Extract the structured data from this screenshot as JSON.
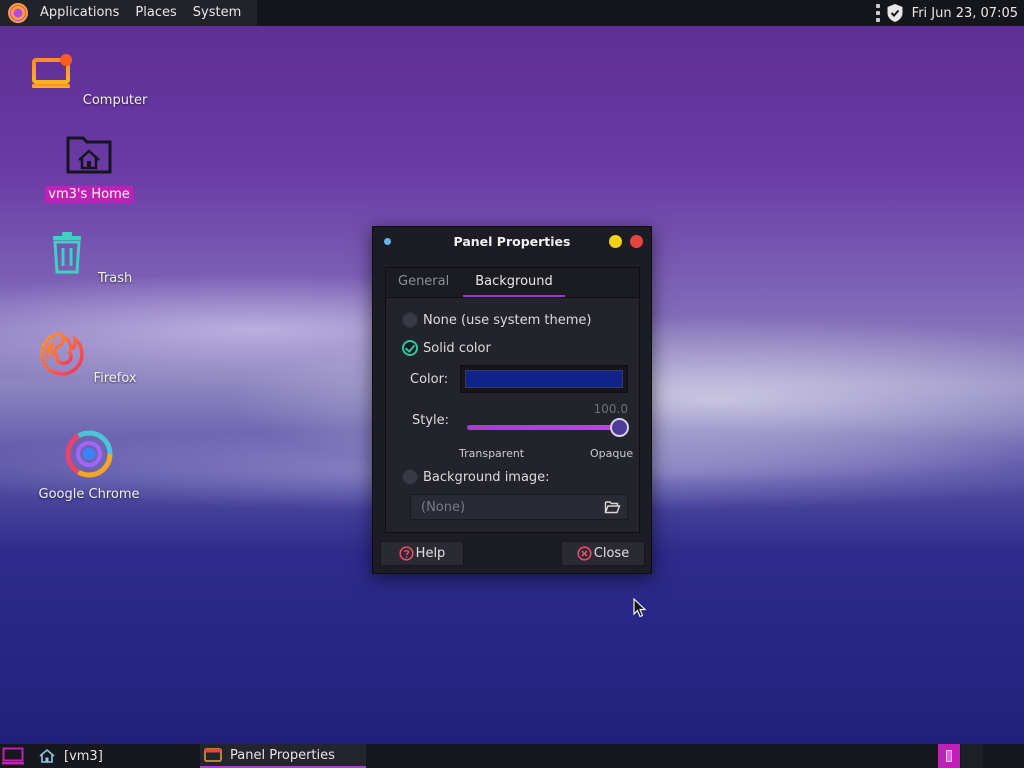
{
  "top_panel": {
    "menus": [
      "Applications",
      "Places",
      "System"
    ],
    "clock": "Fri Jun 23, 07:05"
  },
  "desktop_icons": [
    {
      "label": "Computer",
      "icon": "computer-icon"
    },
    {
      "label": "vm3's Home",
      "icon": "home-folder-icon",
      "selected": true
    },
    {
      "label": "Trash",
      "icon": "trash-icon"
    },
    {
      "label": "Firefox",
      "icon": "firefox-icon"
    },
    {
      "label": "Google Chrome",
      "icon": "chrome-icon"
    }
  ],
  "window": {
    "title": "Panel Properties",
    "tabs": [
      {
        "label": "General"
      },
      {
        "label": "Background",
        "active": true
      }
    ],
    "options": {
      "none_label": "None (use system theme)",
      "solid_label": "Solid color",
      "image_label": "Background image:",
      "selected": "solid"
    },
    "color_label": "Color:",
    "color_value": "#0f238a",
    "style_label": "Style:",
    "slider": {
      "value": "100.0",
      "fraction": 1.0,
      "min_label": "Transparent",
      "max_label": "Opaque"
    },
    "image_chooser": {
      "value": "(None)"
    },
    "buttons": {
      "help": "Help",
      "close": "Close"
    }
  },
  "bottom_panel": {
    "tasks": [
      {
        "label": "[vm3]",
        "icon": "home-icon"
      },
      {
        "label": "Panel Properties",
        "icon": "panel-icon",
        "active": true
      }
    ]
  },
  "colors": {
    "accent": "#c21fb6",
    "tab_underline": "#a033d8",
    "check": "#2ec7a0",
    "minimize": "#f2d21b",
    "close": "#e8443f"
  }
}
